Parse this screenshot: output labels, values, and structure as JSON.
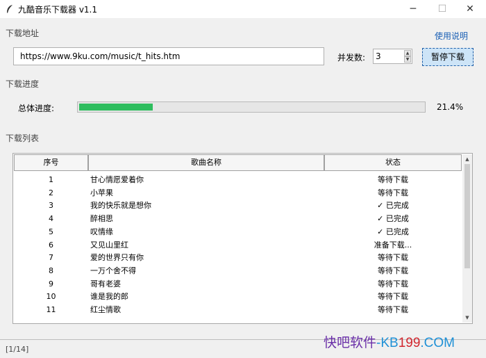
{
  "window": {
    "title": "九酷音乐下载器 v1.1",
    "minimize_label": "─",
    "maximize_label": "☐",
    "close_label": "✕"
  },
  "download_address": {
    "section_label": "下载地址",
    "help_link": "使用说明",
    "url_value": "https://www.9ku.com/music/t_hits.htm",
    "concurrency_label": "并发数:",
    "concurrency_value": "3",
    "pause_button": "暂停下载"
  },
  "progress": {
    "section_label": "下载进度",
    "overall_label": "总体进度:",
    "fraction": 0.214,
    "percent_text": "21.4%"
  },
  "download_list": {
    "section_label": "下载列表",
    "columns": [
      "序号",
      "歌曲名称",
      "状态"
    ],
    "rows": [
      {
        "idx": "1",
        "name": "甘心情愿爱着你",
        "status": "等待下载"
      },
      {
        "idx": "2",
        "name": "小苹果",
        "status": "等待下载"
      },
      {
        "idx": "3",
        "name": "我的快乐就是想你",
        "status": "✓ 已完成"
      },
      {
        "idx": "4",
        "name": "醉相思",
        "status": "✓ 已完成"
      },
      {
        "idx": "5",
        "name": "叹情缘",
        "status": "✓ 已完成"
      },
      {
        "idx": "6",
        "name": "又见山里红",
        "status": "准备下载..."
      },
      {
        "idx": "7",
        "name": "爱的世界只有你",
        "status": "等待下载"
      },
      {
        "idx": "8",
        "name": "一万个舍不得",
        "status": "等待下载"
      },
      {
        "idx": "9",
        "name": "哥有老婆",
        "status": "等待下载"
      },
      {
        "idx": "10",
        "name": "谁是我的郎",
        "status": "等待下载"
      },
      {
        "idx": "11",
        "name": "红尘情歌",
        "status": "等待下载"
      }
    ]
  },
  "status_bar": {
    "text": "[1/14]"
  },
  "watermark": {
    "part1": "快吧软件",
    "part2": "-KB",
    "part3": "199",
    "part4": ".COM"
  },
  "colors": {
    "progress_fill": "#2ebd5e",
    "pause_button_bg": "#cde4f7",
    "help_link": "#1a5fb4"
  }
}
